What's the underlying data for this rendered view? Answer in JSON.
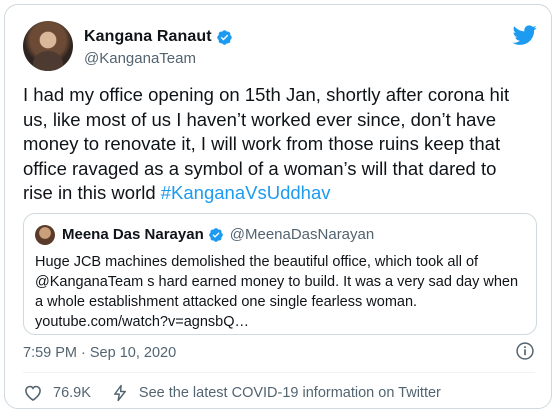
{
  "author": {
    "name": "Kangana Ranaut",
    "handle": "@KanganaTeam"
  },
  "tweet": {
    "text": "I had my office opening on 15th Jan, shortly after corona hit us, like most of us I haven’t worked ever since, don’t have money to renovate it, I will work from those ruins keep that office ravaged as a symbol of a woman’s will that dared to rise in this world ",
    "hashtag": "#KanganaVsUddhav"
  },
  "quote": {
    "name": "Meena Das Narayan",
    "handle": "@MeenaDasNarayan",
    "text": "Huge JCB machines demolished the beautiful office, which took all of @KanganaTeam s hard earned money to build. It was  a very sad day when a whole establishment attacked one single fearless woman. youtube.com/watch?v=agnsbQ…"
  },
  "meta": {
    "timestamp": "7:59 PM · Sep 10, 2020"
  },
  "actions": {
    "like_count": "76.9K",
    "covid_link": "See the latest COVID-19 information on Twitter"
  },
  "colors": {
    "accent": "#1d9bf0",
    "secondary_text": "#536471",
    "border": "#cfd9de"
  },
  "icons": [
    "verified-badge-icon",
    "twitter-bird-icon",
    "info-icon",
    "heart-icon",
    "lightning-bolt-icon"
  ]
}
